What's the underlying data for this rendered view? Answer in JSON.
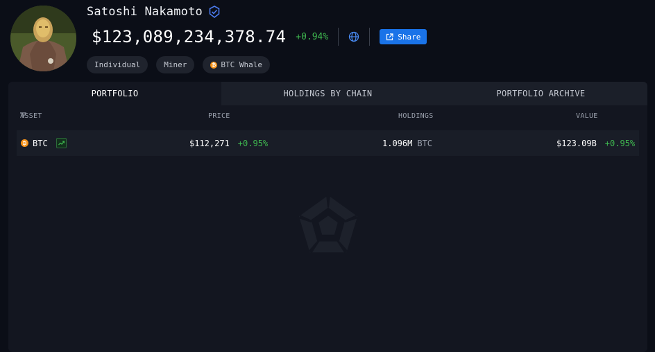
{
  "profile": {
    "name": "Satoshi Nakamoto",
    "total_value": "$123,089,234,378.74",
    "total_change": "+0.94%",
    "share_label": "Share",
    "tags": [
      "Individual",
      "Miner",
      "BTC Whale"
    ]
  },
  "tabs": [
    {
      "label": "PORTFOLIO",
      "active": true
    },
    {
      "label": "HOLDINGS BY CHAIN",
      "active": false
    },
    {
      "label": "PORTFOLIO ARCHIVE",
      "active": false
    }
  ],
  "table": {
    "columns": [
      "ASSET",
      "PRICE",
      "HOLDINGS",
      "VALUE"
    ],
    "rows": [
      {
        "asset": "BTC",
        "price": "$112,271",
        "price_change": "+0.95%",
        "holdings": "1.096M",
        "holdings_unit": "BTC",
        "value": "$123.09B",
        "value_change": "+0.95%"
      }
    ]
  },
  "colors": {
    "accent": "#1a73e8",
    "positive": "#3fb950",
    "btc": "#f7931a",
    "verified": "#4c7cf0"
  }
}
